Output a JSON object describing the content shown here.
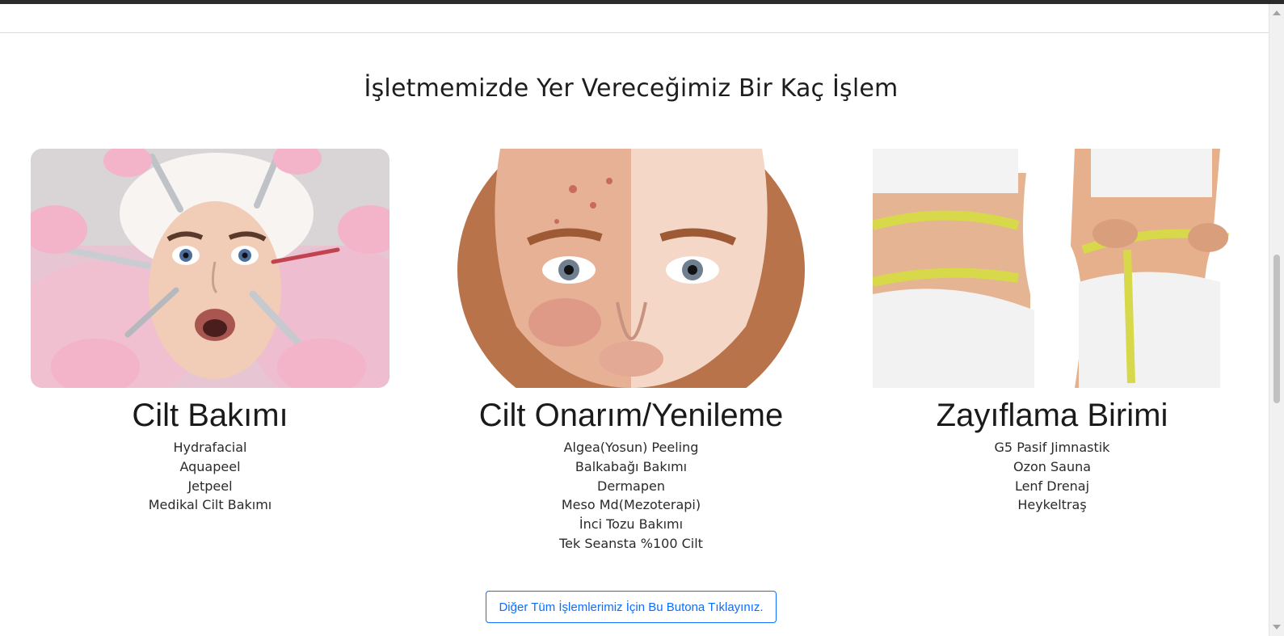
{
  "section": {
    "title": "İşletmemizde Yer Vereceğimiz Bir Kaç İşlem"
  },
  "cards": [
    {
      "title": "Cilt Bakımı",
      "image_alt": "facial-treatment-photo",
      "items": [
        "Hydrafacial",
        "Aquapeel",
        "Jetpeel",
        "Medikal Cilt Bakımı"
      ]
    },
    {
      "title": "Cilt Onarım/Yenileme",
      "image_alt": "skin-before-after-photo",
      "items": [
        "Algea(Yosun) Peeling",
        "Balkabağı Bakımı",
        "Dermapen",
        "Meso Md(Mezoterapi)",
        "İnci Tozu Bakımı",
        "Tek Seansta %100 Cilt"
      ]
    },
    {
      "title": "Zayıflama Birimi",
      "image_alt": "waist-measuring-photo",
      "items": [
        "G5 Pasif Jimnastik",
        "Ozon Sauna",
        "Lenf Drenaj",
        "Heykeltraş"
      ]
    }
  ],
  "cta": {
    "label": "Diğer Tüm İşlemlerimiz İçin Bu Butona Tıklayınız."
  },
  "colors": {
    "accent": "#0d6efd",
    "topbar": "#2b2b2b"
  }
}
